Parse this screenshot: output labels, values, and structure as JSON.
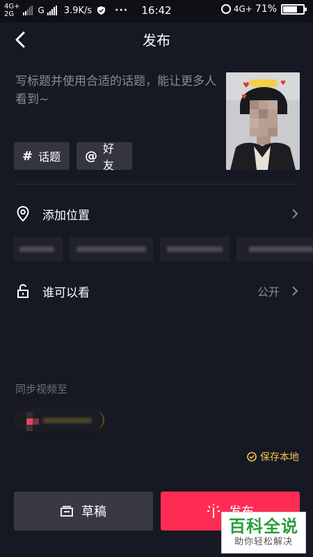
{
  "status_bar": {
    "network1": "4G+",
    "network2": "2G",
    "network3": "G",
    "speed": "3.9K/s",
    "more": "···",
    "time": "16:42",
    "network4": "4G+",
    "battery_text": "71%",
    "battery_level": 0.71
  },
  "header": {
    "title": "发布",
    "back_icon": "chevron-left-icon"
  },
  "caption": {
    "placeholder": "写标题并使用合适的话题，能让更多人看到~"
  },
  "chips": {
    "topic": {
      "symbol": "#",
      "label": "话题"
    },
    "friend": {
      "symbol": "@",
      "label": "好友"
    }
  },
  "location": {
    "label": "添加位置",
    "icon": "location-pin-icon"
  },
  "visibility": {
    "label": "谁可以看",
    "value": "公开",
    "icon": "unlock-icon"
  },
  "sync": {
    "label": "同步视频至"
  },
  "save_local": {
    "label": "保存本地",
    "icon": "check-circle-icon"
  },
  "actions": {
    "draft_label": "草稿",
    "publish_label": "发布"
  },
  "watermark": {
    "big": "百科全说",
    "small": "助你轻松解决"
  },
  "colors": {
    "background": "#161823",
    "accent": "#fe2c55",
    "gold": "#f6c344",
    "watermark_green": "#2a9d3e"
  }
}
